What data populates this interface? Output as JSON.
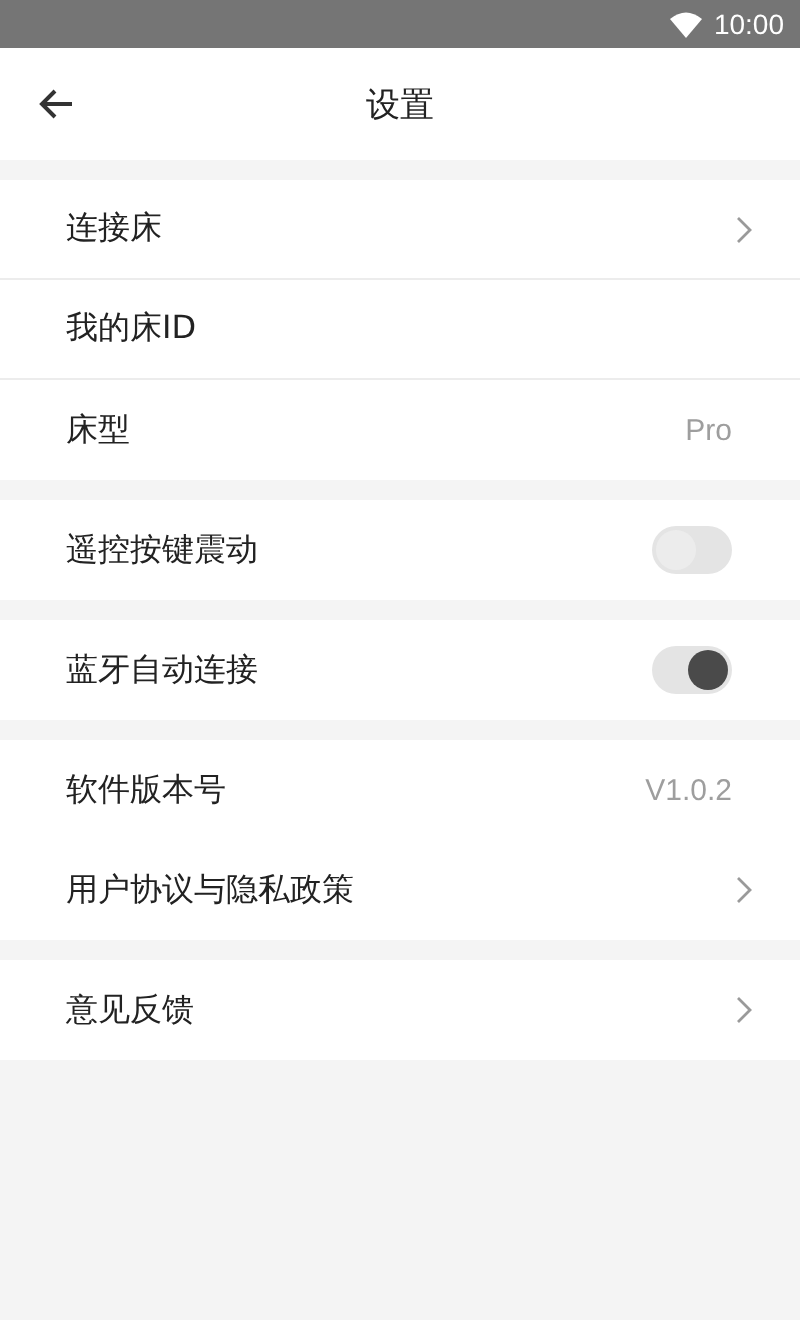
{
  "status_bar": {
    "time": "10:00"
  },
  "header": {
    "title": "设置"
  },
  "groups": [
    {
      "dividers": true,
      "rows": [
        {
          "kind": "link",
          "label": "连接床"
        },
        {
          "kind": "plain",
          "label": "我的床ID"
        },
        {
          "kind": "value",
          "label": "床型",
          "value": "Pro"
        }
      ]
    },
    {
      "rows": [
        {
          "kind": "toggle",
          "label": "遥控按键震动",
          "on": false
        }
      ]
    },
    {
      "rows": [
        {
          "kind": "toggle",
          "label": "蓝牙自动连接",
          "on": true
        }
      ]
    },
    {
      "dividers": false,
      "rows": [
        {
          "kind": "value",
          "label": "软件版本号",
          "value": "V1.0.2"
        },
        {
          "kind": "link",
          "label": "用户协议与隐私政策"
        }
      ]
    },
    {
      "rows": [
        {
          "kind": "link",
          "label": "意见反馈"
        }
      ]
    }
  ]
}
